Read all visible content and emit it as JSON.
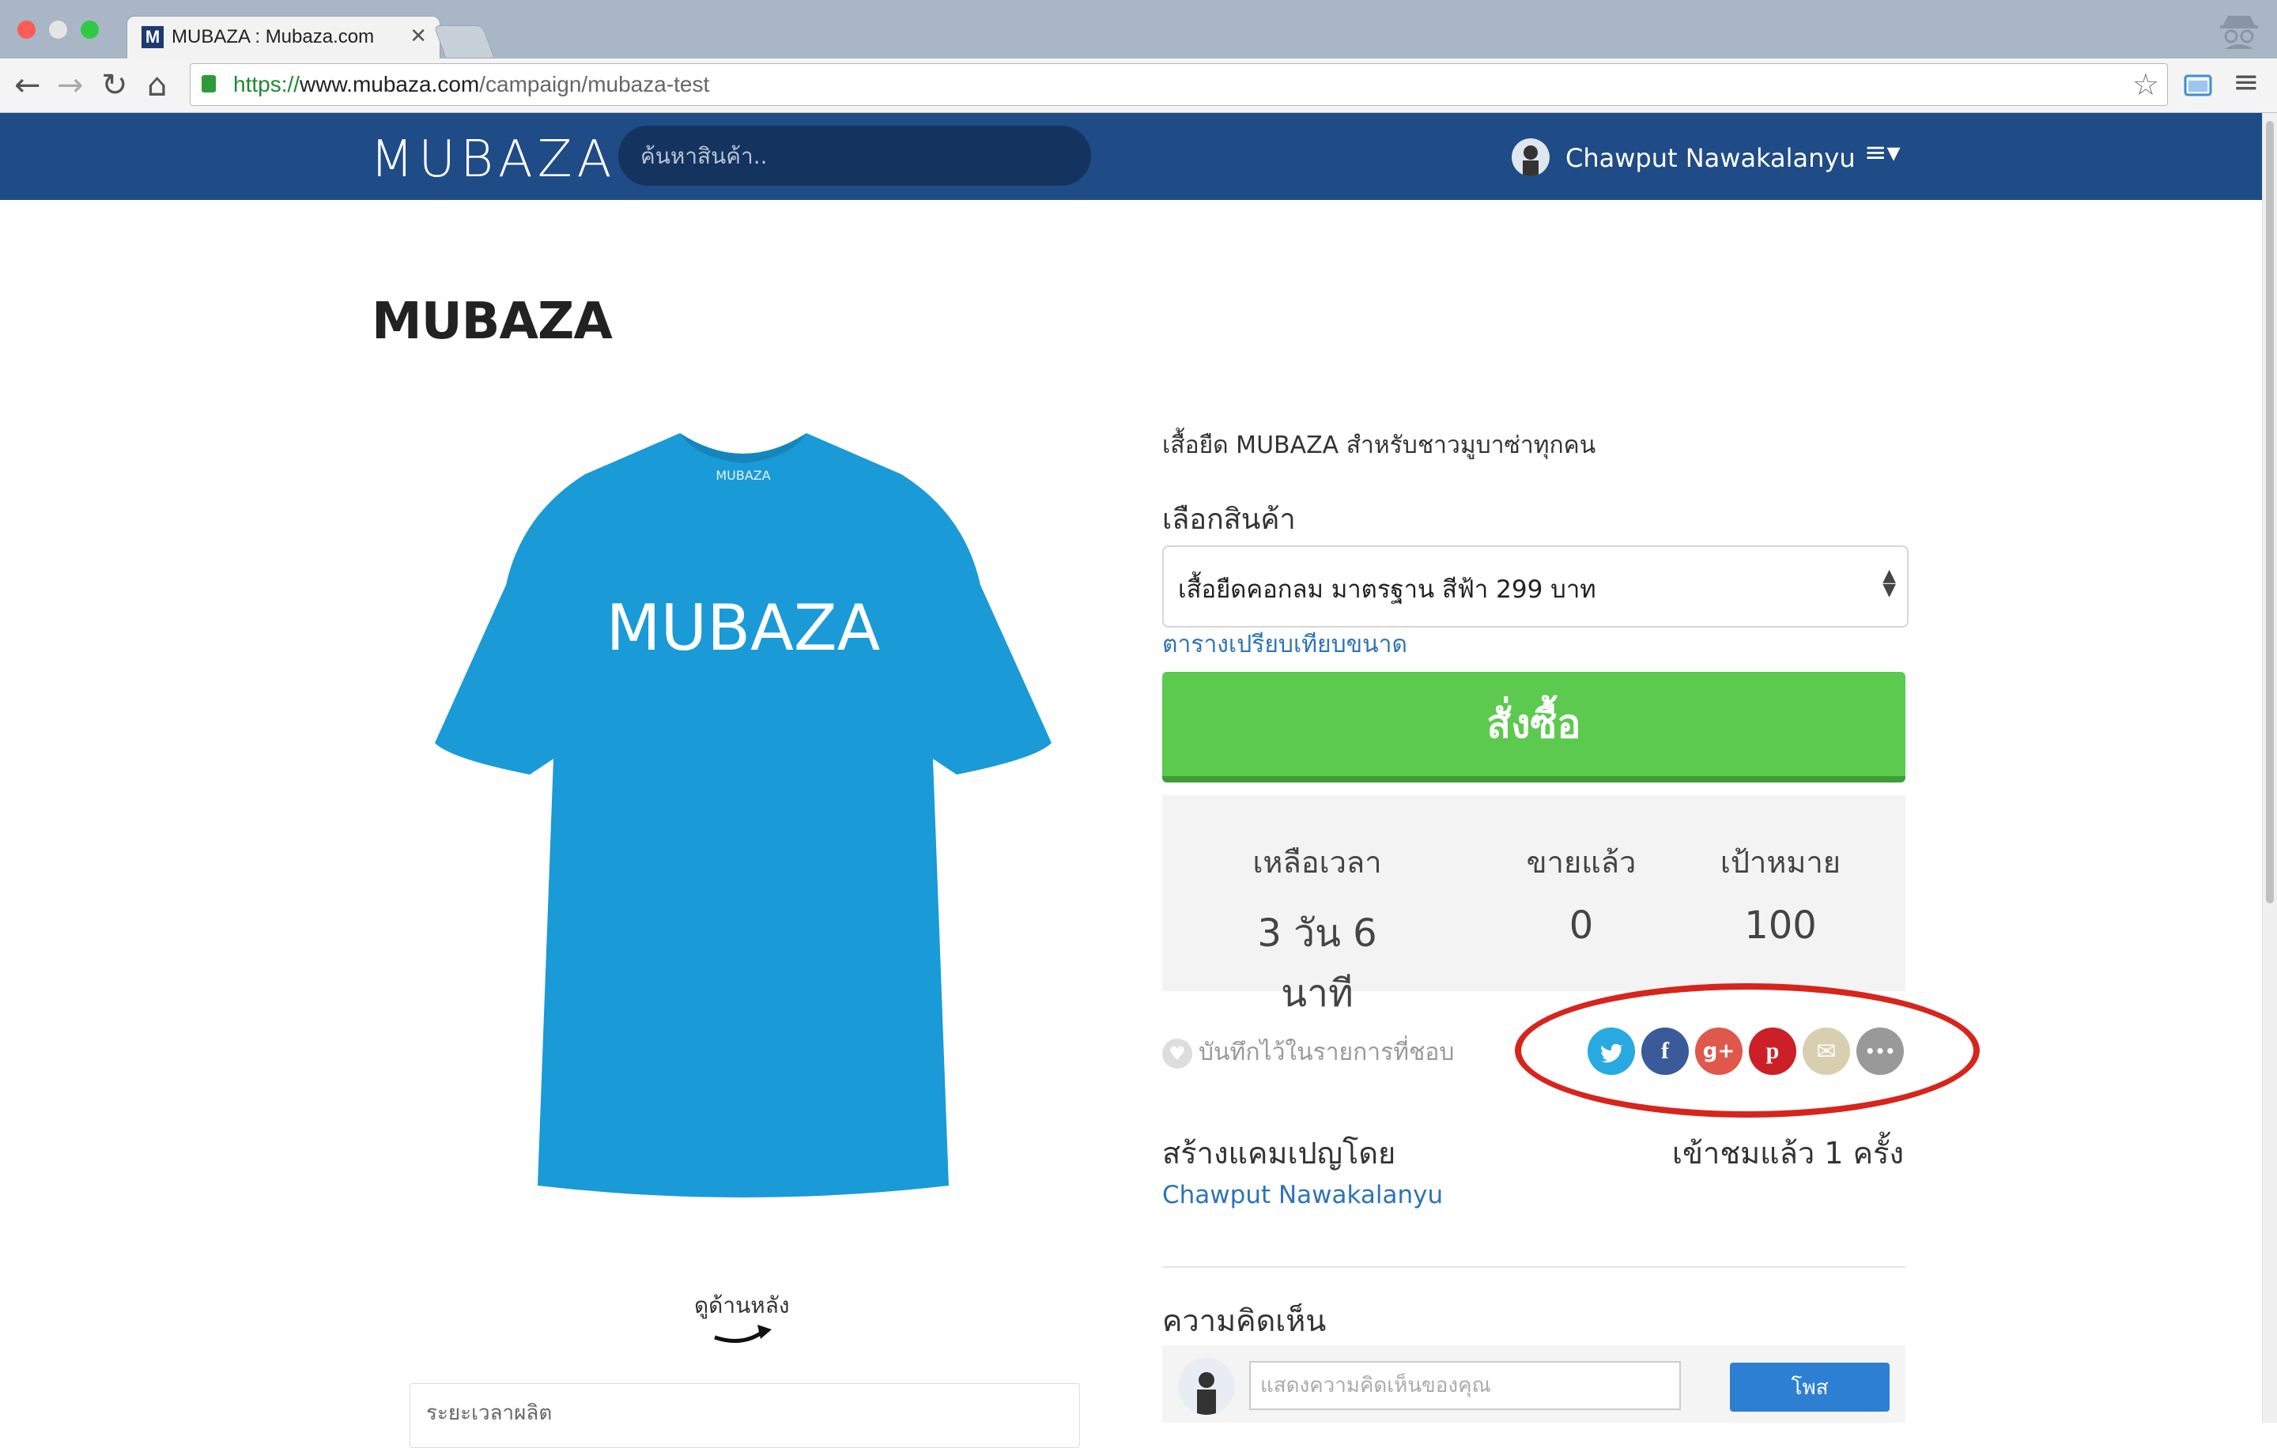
{
  "browser": {
    "tab_title": "MUBAZA : Mubaza.com",
    "tab_favicon": "M",
    "tab_close": "✕",
    "url_scheme": "https://",
    "url_host": "www.mubaza.com",
    "url_path": "/campaign/mubaza-test"
  },
  "site": {
    "logo": "MUBAZA",
    "search_placeholder": "ค้นหาสินค้า..",
    "user_name": "Chawput Nawakalanyu"
  },
  "page": {
    "title": "MUBAZA",
    "shirt_print": "MUBAZA",
    "shirt_tag": "MUBAZA",
    "back_view": "ดูด้านหลัง",
    "production_label": "ระยะเวลาผลิต",
    "description": "เสื้อยืด MUBAZA สำหรับชาวมูบาซ่าทุกคน",
    "select_label": "เลือกสินค้า",
    "selected_option": "เสื้อยืดคอกลม มาตรฐาน สีฟ้า 299 บาท",
    "size_chart_link": "ตารางเปรียบเทียบขนาด",
    "buy_button": "สั่งซื้อ",
    "stats": [
      {
        "label": "เหลือเวลา",
        "value": "3 วัน 6 นาที"
      },
      {
        "label": "ขายแล้ว",
        "value": "0"
      },
      {
        "label": "เป้าหมาย",
        "value": "100"
      }
    ],
    "favorite_label": "บันทึกไว้ในรายการที่ชอบ",
    "share": {
      "twitter": "twitter-icon",
      "facebook": "f",
      "google": "g+",
      "pinterest": "p",
      "email": "✉",
      "more": "•••"
    },
    "created_by_label": "สร้างแคมเปญโดย",
    "views_label": "เข้าชมแล้ว 1 ครั้ง",
    "creator_name": "Chawput Nawakalanyu",
    "comments_title": "ความคิดเห็น",
    "comment_placeholder": "แสดงความคิดเห็นของคุณ",
    "post_button": "โพส"
  },
  "colors": {
    "nav": "#1f4b86",
    "buy": "#5cc94f",
    "shirt": "#1a9ad6",
    "highlight": "#d7241c",
    "twitter": "#29a9e1",
    "facebook": "#3b5a9a",
    "google": "#e0584b",
    "pinterest": "#cb2027",
    "email": "#d8cfb0",
    "more": "#999999"
  }
}
